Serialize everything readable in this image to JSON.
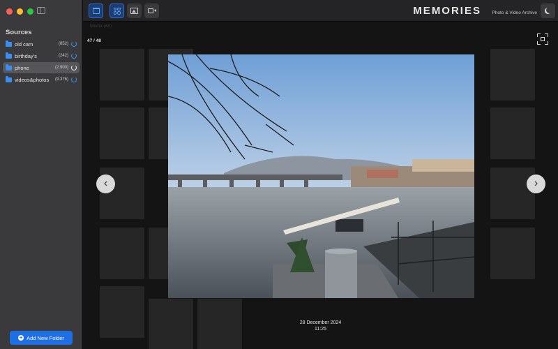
{
  "window": {
    "sidebar": {
      "title": "Sources",
      "items": [
        {
          "name": "old cam",
          "count": "(852)",
          "active": false
        },
        {
          "name": "birthday's",
          "count": "(242)",
          "active": false
        },
        {
          "name": "phone",
          "count": "(2.900)",
          "active": true
        },
        {
          "name": "videos&photos",
          "count": "(9.376)",
          "active": false
        }
      ],
      "add_button": "Add New Folder"
    },
    "toolbar": {
      "tools": [
        "calendar-icon",
        "grid-icon",
        "image-icon",
        "video-icon"
      ],
      "brand": "MEMORIES",
      "brand_sub": "Photo & Video Archive"
    }
  },
  "viewer": {
    "background_label": "Media (48)",
    "counter": "47 / 48",
    "date": "28 December 2024",
    "time": "11:25",
    "prev_glyph": "‹",
    "next_glyph": "›"
  },
  "colors": {
    "accent": "#1e6fe6",
    "folder": "#3a8ff0"
  }
}
